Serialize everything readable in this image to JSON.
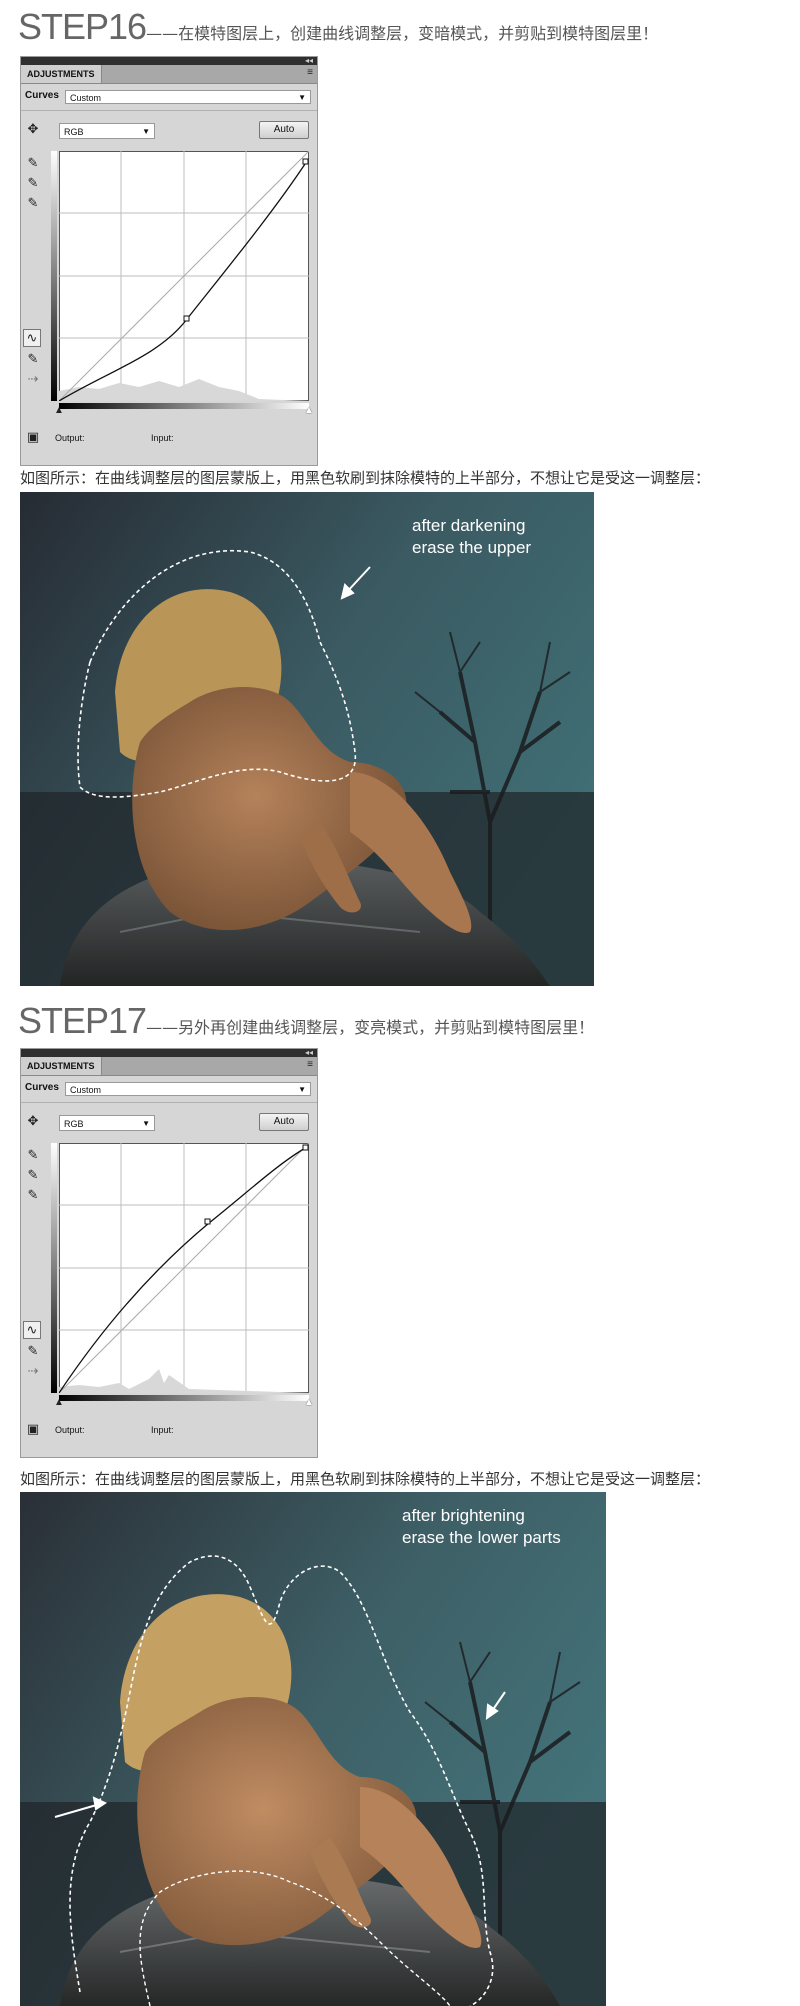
{
  "steps": [
    {
      "number": "STEP16",
      "dash": "——",
      "description": "在模特图层上，创建曲线调整层，变暗模式，并剪贴到模特图层里！",
      "panel": {
        "tab_label": "ADJUSTMENTS",
        "panel_controls": "◂◂",
        "menu_icon": "≡",
        "adjustment_label": "Curves",
        "preset_value": "Custom",
        "channel_value": "RGB",
        "auto_label": "Auto",
        "output_label": "Output:",
        "input_label": "Input:"
      },
      "caption": "如图所示：在曲线调整层的图层蒙版上，用黑色软刷到抹除模特的上半部分，不想让它是受这一调整层：",
      "annotation_line1": "after darkening",
      "annotation_line2": "erase the upper"
    },
    {
      "number": "STEP17",
      "dash": "——",
      "description": "另外再创建曲线调整层，变亮模式，并剪贴到模特图层里！",
      "panel": {
        "tab_label": "ADJUSTMENTS",
        "panel_controls": "◂◂",
        "menu_icon": "≡",
        "adjustment_label": "Curves",
        "preset_value": "Custom",
        "channel_value": "RGB",
        "auto_label": "Auto",
        "output_label": "Output:",
        "input_label": "Input:"
      },
      "caption": "如图所示：在曲线调整层的图层蒙版上，用黑色软刷到抹除模特的上半部分，不想让它是受这一调整层：",
      "annotation_line1": "after brightening",
      "annotation_line2": "erase the lower parts"
    }
  ],
  "colors": {
    "panel_bg": "#d6d6d6",
    "sky_dark": "#2a3038",
    "sky_teal": "#3f6b72",
    "skin": "#a8774f",
    "hair": "#b89556",
    "rock": "#3a3b3a"
  }
}
